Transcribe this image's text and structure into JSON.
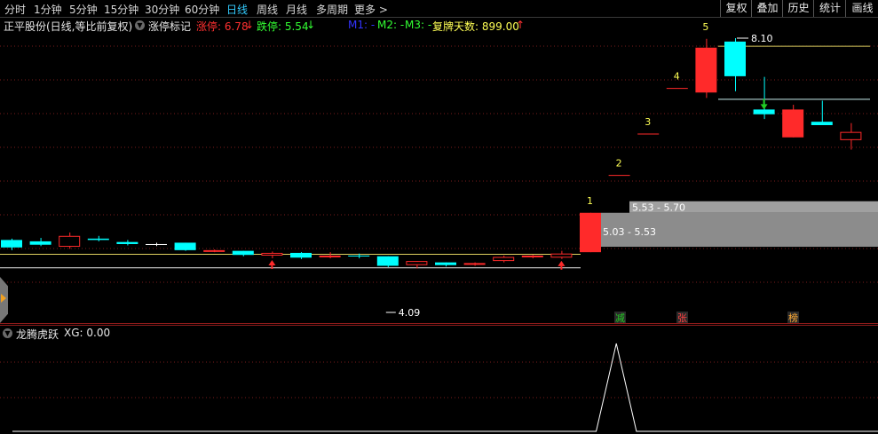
{
  "toolbar": {
    "periods": [
      "分时",
      "1分钟",
      "5分钟",
      "15分钟",
      "30分钟",
      "60分钟",
      "日线",
      "周线",
      "月线",
      "多周期",
      "更多 >"
    ],
    "active_period": "日线",
    "right_buttons": [
      "复权",
      "叠加",
      "历史",
      "统计",
      "画线"
    ]
  },
  "info_bar": {
    "stock_title": "正平股份(日线,等比前复权)",
    "indicator_name": "涨停标记",
    "limit_up_label": "涨停: 6.78",
    "limit_up_arrow": "↓",
    "limit_down_label": "跌停: 5.54",
    "limit_down_arrow": "↓",
    "m1": "M1: -",
    "m2": "M2: -",
    "m3": "M3: -",
    "reopen_label": "复牌天数: 899.00",
    "reopen_arrow": "↑"
  },
  "colors": {
    "up": "#ff2a2a",
    "down": "#00ffff",
    "doji": "#ffffff",
    "yellow_label": "#ffff55",
    "gray_box": "#8c8c8c",
    "green_arrow": "#22cc22"
  },
  "chart_data": {
    "type": "candlestick",
    "candles": [
      {
        "o": 5.13,
        "h": 5.15,
        "l": 4.98,
        "c": 5.02
      },
      {
        "o": 5.11,
        "h": 5.16,
        "l": 5.04,
        "c": 5.06
      },
      {
        "o": 5.03,
        "h": 5.24,
        "l": 5.0,
        "c": 5.19
      },
      {
        "o": 5.15,
        "h": 5.19,
        "l": 5.11,
        "c": 5.13
      },
      {
        "o": 5.1,
        "h": 5.13,
        "l": 5.05,
        "c": 5.07
      },
      {
        "o": 5.07,
        "h": 5.09,
        "l": 5.04,
        "c": 5.07
      },
      {
        "o": 5.09,
        "h": 5.09,
        "l": 4.97,
        "c": 4.98
      },
      {
        "o": 4.97,
        "h": 4.99,
        "l": 4.95,
        "c": 4.98
      },
      {
        "o": 4.97,
        "h": 4.97,
        "l": 4.89,
        "c": 4.91
      },
      {
        "o": 4.9,
        "h": 4.96,
        "l": 4.86,
        "c": 4.94
      },
      {
        "o": 4.94,
        "h": 4.95,
        "l": 4.85,
        "c": 4.87
      },
      {
        "o": 4.88,
        "h": 4.95,
        "l": 4.86,
        "c": 4.9
      },
      {
        "o": 4.9,
        "h": 4.93,
        "l": 4.86,
        "c": 4.89
      },
      {
        "o": 4.89,
        "h": 4.89,
        "l": 4.73,
        "c": 4.75
      },
      {
        "o": 4.76,
        "h": 4.82,
        "l": 4.71,
        "c": 4.82
      },
      {
        "o": 4.8,
        "h": 4.8,
        "l": 4.74,
        "c": 4.76
      },
      {
        "o": 4.78,
        "h": 4.8,
        "l": 4.75,
        "c": 4.79
      },
      {
        "o": 4.82,
        "h": 4.9,
        "l": 4.8,
        "c": 4.88
      },
      {
        "o": 4.88,
        "h": 4.91,
        "l": 4.86,
        "c": 4.9
      },
      {
        "o": 4.87,
        "h": 4.97,
        "l": 4.85,
        "c": 4.93
      },
      {
        "o": 4.95,
        "h": 5.53,
        "l": 4.95,
        "c": 5.53
      },
      {
        "o": 6.08,
        "h": 6.08,
        "l": 6.08,
        "c": 6.08
      },
      {
        "o": 6.69,
        "h": 6.69,
        "l": 6.69,
        "c": 6.69
      },
      {
        "o": 7.36,
        "h": 7.36,
        "l": 7.36,
        "c": 7.36
      },
      {
        "o": 7.3,
        "h": 8.09,
        "l": 7.22,
        "c": 7.96
      },
      {
        "o": 8.05,
        "h": 8.1,
        "l": 7.32,
        "c": 7.54
      },
      {
        "o": 7.05,
        "h": 7.53,
        "l": 6.91,
        "c": 6.98
      },
      {
        "o": 6.64,
        "h": 7.12,
        "l": 6.64,
        "c": 7.05
      },
      {
        "o": 6.87,
        "h": 7.18,
        "l": 6.82,
        "c": 6.82
      },
      {
        "o": 6.6,
        "h": 6.85,
        "l": 6.46,
        "c": 6.72
      }
    ],
    "limit_labels": [
      "1",
      "2",
      "3",
      "4",
      "5"
    ],
    "box_labels": [
      "5.03 - 5.53",
      "5.53 - 5.70"
    ],
    "high_annotation": "8.10",
    "low_annotation": "4.09",
    "hlines": [
      4.92,
      4.72,
      7.98,
      7.2
    ],
    "event_tags": [
      "减",
      "张",
      "榜"
    ]
  },
  "sub_chart": {
    "title": "龙腾虎跃",
    "value_label": "XG: 0.00",
    "series": [
      0,
      0,
      0,
      0,
      0,
      0,
      0,
      0,
      0,
      0,
      0,
      0,
      0,
      0,
      0,
      0,
      0,
      0,
      0,
      0,
      0,
      0,
      0,
      0,
      0,
      0,
      0,
      0,
      0,
      0,
      1,
      0,
      0,
      0,
      0,
      0,
      0,
      0,
      0,
      0,
      0,
      0,
      0,
      0
    ]
  }
}
